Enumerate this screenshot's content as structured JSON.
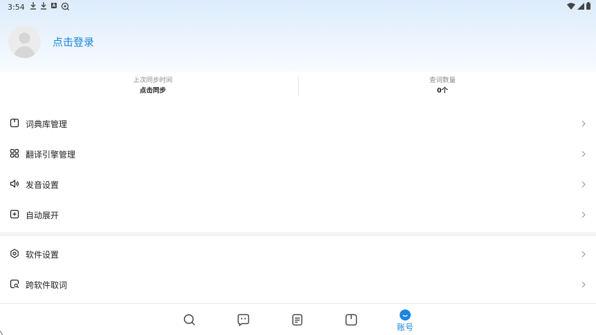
{
  "status_bar": {
    "time": "3:54",
    "left_icons": [
      "download-icon",
      "download-icon",
      "app-store-icon",
      "scan-search-icon"
    ],
    "right_icons": [
      "wifi-icon",
      "signal-icon",
      "battery-icon"
    ]
  },
  "profile": {
    "login_label": "点击登录",
    "avatar_icon": "default-avatar-icon"
  },
  "stats": {
    "last_sync_label": "上次同步时间",
    "last_sync_value": "点击同步",
    "lookup_count_label": "查词数量",
    "lookup_count_value": "0个"
  },
  "menu_group_1": [
    {
      "label": "词典库管理",
      "icon": "dictionary-icon"
    },
    {
      "label": "翻译引擎管理",
      "icon": "grid-icon"
    },
    {
      "label": "发音设置",
      "icon": "speaker-icon"
    },
    {
      "label": "自动展开",
      "icon": "expand-icon"
    }
  ],
  "menu_group_2": [
    {
      "label": "软件设置",
      "icon": "settings-icon"
    },
    {
      "label": "跨软件取词",
      "icon": "cross-app-lookup-icon"
    }
  ],
  "tabbar": {
    "tabs": [
      {
        "icon": "search-icon",
        "label": ""
      },
      {
        "icon": "chat-icon",
        "label": ""
      },
      {
        "icon": "notes-icon",
        "label": ""
      },
      {
        "icon": "book-icon",
        "label": ""
      },
      {
        "icon": "account-icon",
        "label": "账号"
      }
    ],
    "active_index": 4
  },
  "colors": {
    "accent": "#1a86e0",
    "header_gradient_top": "#dcebfb",
    "separator": "#f4f4f4"
  }
}
